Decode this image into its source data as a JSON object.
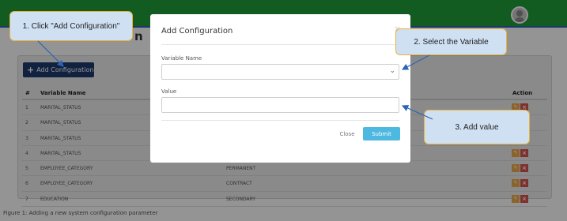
{
  "page": {
    "heading_fragment": "n",
    "add_button_label": "Add Configuration",
    "caption": "Figure 1: Adding a new system configuration parameter"
  },
  "table": {
    "headers": {
      "num": "#",
      "variable": "Variable Name",
      "action": "Action"
    },
    "rows": [
      {
        "num": "1",
        "variable": "MARITAL_STATUS",
        "value": ""
      },
      {
        "num": "2",
        "variable": "MARITAL_STATUS",
        "value": ""
      },
      {
        "num": "3",
        "variable": "MARITAL_STATUS",
        "value": ""
      },
      {
        "num": "4",
        "variable": "MARITAL_STATUS",
        "value": ""
      },
      {
        "num": "5",
        "variable": "EMPLOYEE_CATEGORY",
        "value": "PERMANENT"
      },
      {
        "num": "6",
        "variable": "EMPLOYEE_CATEGORY",
        "value": "CONTRACT"
      },
      {
        "num": "7",
        "variable": "EDUCATION",
        "value": "SECONDARY"
      }
    ]
  },
  "modal": {
    "title": "Add Configuration",
    "close_glyph": "×",
    "variable_label": "Variable Name",
    "variable_value": "",
    "value_label": "Value",
    "value_value": "",
    "close_button": "Close",
    "submit_button": "Submit"
  },
  "annotations": {
    "step1": "1. Click \"Add Configuration\"",
    "step2": "2. Select the Variable",
    "step3": "3. Add value"
  },
  "colors": {
    "topbar": "#1f9d3a",
    "add_button": "#1e3a6e",
    "submit": "#4db8e0",
    "edit": "#f0ad4e",
    "delete": "#d9534f",
    "annotation_fill": "#cfe0f3",
    "annotation_border": "#e9b33a"
  },
  "icons": {
    "plus": "plus-icon",
    "chevron": "chevron-down-icon",
    "edit": "pencil-icon",
    "delete": "x-icon",
    "avatar": "user-avatar-icon"
  }
}
